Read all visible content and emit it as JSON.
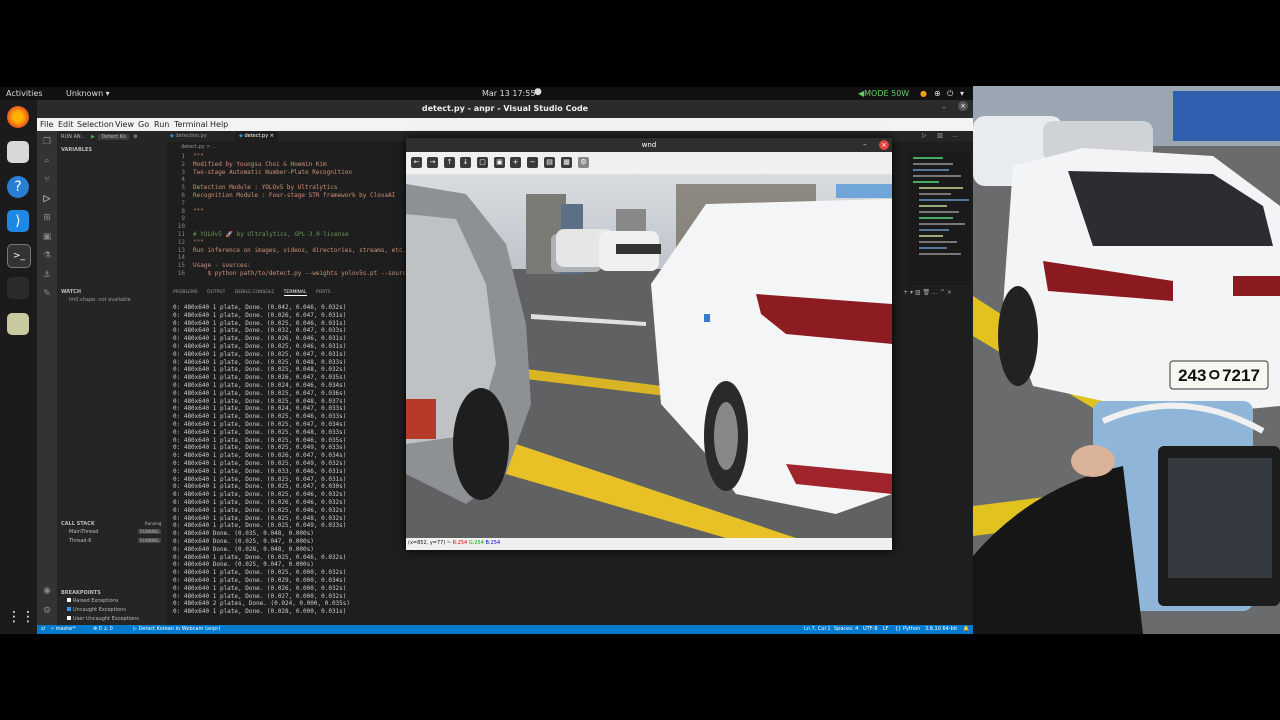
{
  "topbar": {
    "activities": "Activities",
    "app": "Unknown ▾",
    "clock": "Mar 13  17:55",
    "mode": "MODE 50W"
  },
  "vscode": {
    "title": "detect.py - anpr - Visual Studio Code",
    "menu": [
      "File",
      "Edit",
      "Selection",
      "View",
      "Go",
      "Run",
      "Terminal",
      "Help"
    ],
    "run_label": "RUN AN...",
    "run_config": "Detect Ko",
    "tabs": [
      "detection.py",
      "detect.py"
    ],
    "breadcrumb": "detect.py > ...",
    "sidebar": {
      "variables": "VARIABLES",
      "watch": "WATCH",
      "watch_item": "im0.shape: not available",
      "call_stack": "CALL STACK",
      "call_stack_status": "Running",
      "threads": [
        {
          "name": "MainThread",
          "state": "RUNNING"
        },
        {
          "name": "Thread-6",
          "state": "RUNNING"
        }
      ],
      "breakpoints": "BREAKPOINTS",
      "bp_items": [
        "Raised Exceptions",
        "Uncaught Exceptions",
        "User Uncaught Exceptions"
      ]
    },
    "code_lines": [
      {
        "n": "1",
        "t": "\"\"\""
      },
      {
        "n": "2",
        "t": "Modified by Youngsu Choi & Hoemin Kim"
      },
      {
        "n": "3",
        "t": "Two-stage Automatic Number-Plate Recognition"
      },
      {
        "n": "4",
        "t": ""
      },
      {
        "n": "5",
        "t": "Detection Module : YOLOv5 by Ultralytics"
      },
      {
        "n": "6",
        "t": "Recognition Module : Four-stage STR framework by ClovaAI"
      },
      {
        "n": "7",
        "t": ""
      },
      {
        "n": "8",
        "t": "\"\"\""
      },
      {
        "n": "9",
        "t": ""
      },
      {
        "n": "10",
        "t": ""
      },
      {
        "n": "11",
        "t": "# YOLOv5 🚀 by Ultralytics, GPL-3.0 license"
      },
      {
        "n": "12",
        "t": "\"\"\""
      },
      {
        "n": "13",
        "t": "Run inference on images, videos, directories, streams, etc."
      },
      {
        "n": "14",
        "t": ""
      },
      {
        "n": "15",
        "t": "Usage - sources:"
      },
      {
        "n": "16",
        "t": "    $ python path/to/detect.py --weights yolov5s.pt --source"
      }
    ],
    "panel_tabs": [
      "PROBLEMS",
      "OUTPUT",
      "DEBUG CONSOLE",
      "TERMINAL",
      "PORTS"
    ],
    "terminal_lines": [
      "0: 480x640 1 plate, Done. (0.042, 0.046, 0.032s)",
      "0: 480x640 1 plate, Done. (0.026, 0.047, 0.031s)",
      "0: 480x640 1 plate, Done. (0.025, 0.046, 0.031s)",
      "0: 480x640 1 plate, Done. (0.032, 0.047, 0.033s)",
      "0: 480x640 1 plate, Done. (0.026, 0.046, 0.031s)",
      "0: 480x640 1 plate, Done. (0.025, 0.046, 0.031s)",
      "0: 480x640 1 plate, Done. (0.025, 0.047, 0.031s)",
      "0: 480x640 1 plate, Done. (0.025, 0.048, 0.033s)",
      "0: 480x640 1 plate, Done. (0.025, 0.048, 0.032s)",
      "0: 480x640 1 plate, Done. (0.026, 0.047, 0.035s)",
      "0: 480x640 1 plate, Done. (0.024, 0.046, 0.034s)",
      "0: 480x640 1 plate, Done. (0.025, 0.047, 0.036s)",
      "0: 480x640 1 plate, Done. (0.025, 0.048, 0.037s)",
      "0: 480x640 1 plate, Done. (0.024, 0.047, 0.033s)",
      "0: 480x640 1 plate, Done. (0.025, 0.046, 0.033s)",
      "0: 480x640 1 plate, Done. (0.025, 0.047, 0.034s)",
      "0: 480x640 1 plate, Done. (0.025, 0.048, 0.033s)",
      "0: 480x640 1 plate, Done. (0.025, 0.046, 0.035s)",
      "0: 480x640 1 plate, Done. (0.025, 0.049, 0.033s)",
      "0: 480x640 1 plate, Done. (0.026, 0.047, 0.034s)",
      "0: 480x640 1 plate, Done. (0.025, 0.049, 0.032s)",
      "0: 480x640 1 plate, Done. (0.033, 0.046, 0.031s)",
      "0: 480x640 1 plate, Done. (0.025, 0.047, 0.031s)",
      "0: 480x640 1 plate, Done. (0.025, 0.047, 0.030s)",
      "0: 480x640 1 plate, Done. (0.025, 0.046, 0.032s)",
      "0: 480x640 1 plate, Done. (0.026, 0.046, 0.032s)",
      "0: 480x640 1 plate, Done. (0.025, 0.046, 0.032s)",
      "0: 480x640 1 plate, Done. (0.025, 0.048, 0.032s)",
      "0: 480x640 1 plate, Done. (0.025, 0.049, 0.033s)",
      "0: 480x640 Done. (0.035, 0.048, 0.000s)",
      "0: 480x640 Done. (0.025, 0.047, 0.000s)",
      "0: 480x640 Done. (0.028, 0.048, 0.000s)",
      "0: 480x640 1 plate, Done. (0.025, 0.046, 0.032s)",
      "0: 480x640 Done. (0.025, 0.047, 0.000s)",
      "0: 480x640 1 plate, Done. (0.025, 0.000, 0.032s)",
      "0: 480x640 1 plate, Done. (0.029, 0.000, 0.034s)",
      "0: 480x640 1 plate, Done. (0.026, 0.000, 0.032s)",
      "0: 480x640 1 plate, Done. (0.027, 0.000, 0.032s)",
      "0: 480x640 2 plates, Done. (0.024, 0.000, 0.035s)",
      "0: 480x640 1 plate, Done. (0.028, 0.000, 0.031s)"
    ],
    "status": {
      "branch": "master*",
      "errors": "⊗ 0 ⚠ 0",
      "debug": "Detect Korean in Webcam (anpr)",
      "position": "Ln 7, Col 1",
      "spaces": "Spaces: 4",
      "encoding": "UTF-8",
      "eol": "LF",
      "language": "Python",
      "interpreter": "3.8.10 64-bit"
    }
  },
  "wnd": {
    "title": "wnd",
    "status_coords": "(x=852, y=77) ~ ",
    "status_r": "R:254",
    "status_g": "G:254",
    "status_b": "B:254"
  },
  "camera": {
    "plate": "243ㅇ7217"
  },
  "colors": {
    "accent": "#007acc",
    "close_red": "#e0443e"
  }
}
